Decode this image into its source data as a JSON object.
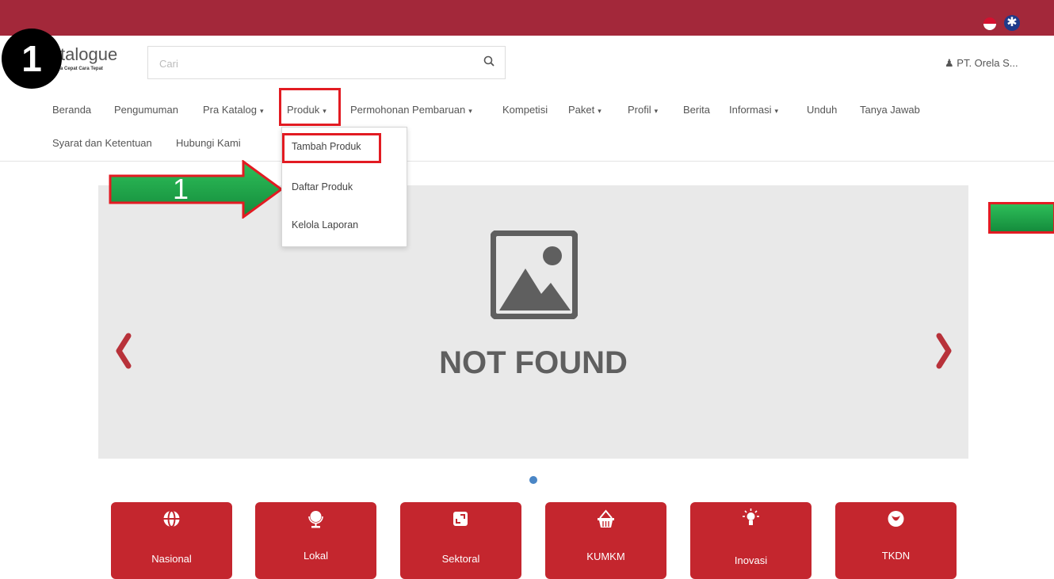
{
  "header": {
    "logo_text": "talogue",
    "logo_sub": "a Cepat Cara Tepat",
    "search_placeholder": "Cari",
    "user_name": "PT. Orela S..."
  },
  "annotation": {
    "step_badge": "1",
    "arrow_label": "1",
    "highlight_color": "#e21b22",
    "arrow_color": "#1fa84a"
  },
  "nav": {
    "items": [
      {
        "label": "Beranda"
      },
      {
        "label": "Pengumuman"
      },
      {
        "label": "Pra Katalog",
        "dropdown": true
      },
      {
        "label": "Produk",
        "dropdown": true,
        "active": true
      },
      {
        "label": "Permohonan Pembaruan",
        "dropdown": true
      },
      {
        "label": "Kompetisi"
      },
      {
        "label": "Paket",
        "dropdown": true
      },
      {
        "label": "Profil",
        "dropdown": true
      },
      {
        "label": "Berita"
      },
      {
        "label": "Informasi",
        "dropdown": true
      },
      {
        "label": "Unduh"
      },
      {
        "label": "Tanya Jawab"
      },
      {
        "label": "Syarat dan Ketentuan"
      },
      {
        "label": "Hubungi Kami"
      }
    ],
    "caret": "▾"
  },
  "produk_menu": {
    "items": [
      "Tambah Produk",
      "Daftar Produk",
      "Kelola Laporan"
    ]
  },
  "banner": {
    "image_text": "NOT FOUND"
  },
  "categories": [
    {
      "label": "Nasional",
      "icon": "globe-icon"
    },
    {
      "label": "Lokal",
      "icon": "desk-globe-icon"
    },
    {
      "label": "Sektoral",
      "icon": "expand-square-icon"
    },
    {
      "label": "KUMKM",
      "icon": "basket-icon"
    },
    {
      "label": "Inovasi",
      "icon": "lightbulb-icon"
    },
    {
      "label": "TKDN",
      "icon": "leaf-shield-icon"
    }
  ],
  "colors": {
    "topbar": "#a3283a",
    "tile": "#c4262e",
    "carousel_chevron": "#b8323a",
    "carousel_dot": "#4a86c6"
  }
}
